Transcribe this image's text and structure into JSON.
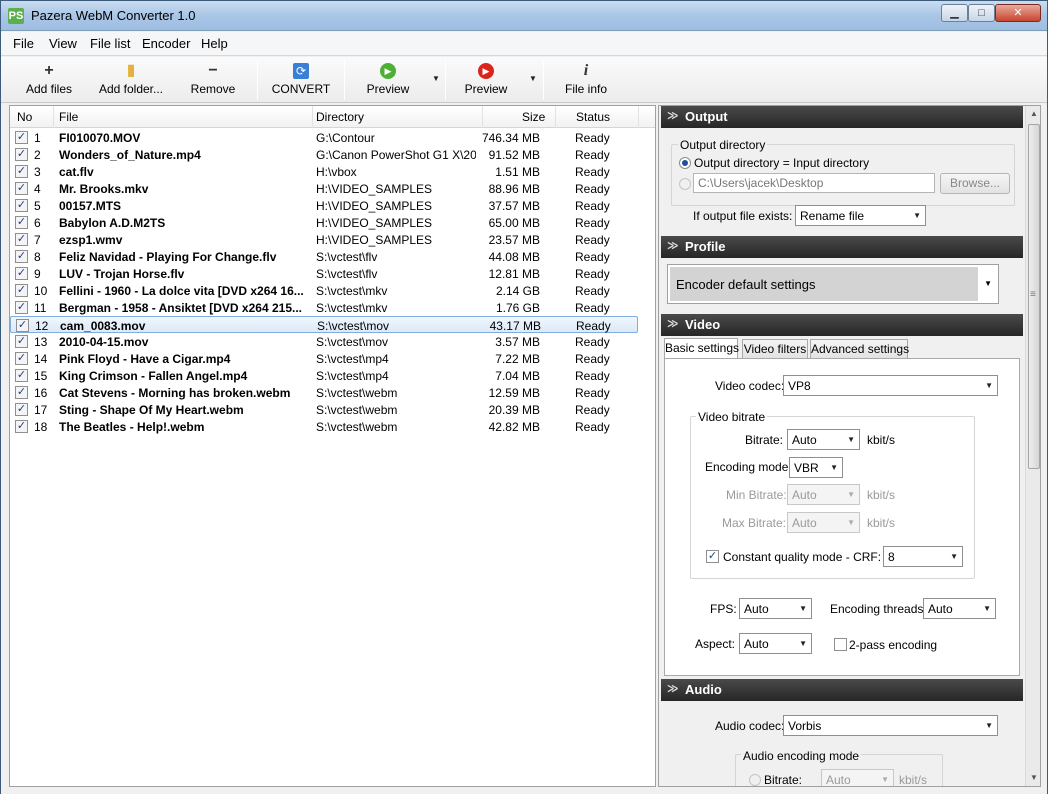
{
  "window": {
    "title": "Pazera WebM Converter 1.0",
    "app_icon": "PS"
  },
  "window_controls": {
    "minimize": "▁",
    "maximize": "□",
    "close": "✕"
  },
  "menu": [
    "File",
    "View",
    "File list",
    "Encoder",
    "Help"
  ],
  "toolbar": {
    "add_files": "Add files",
    "add_folder": "Add folder...",
    "remove": "Remove",
    "convert": "CONVERT",
    "preview1": "Preview",
    "preview2": "Preview",
    "file_info": "File info",
    "icons": {
      "add": "+",
      "folder": "▮",
      "remove": "−",
      "convert": "⟳",
      "play_green": "▶",
      "play_red": "▶",
      "info": "i"
    }
  },
  "file_list": {
    "columns": [
      "No",
      "File",
      "Directory",
      "Size",
      "Status"
    ],
    "rows": [
      {
        "no": "1",
        "file": "FI010070.MOV",
        "dir": "G:\\Contour",
        "size": "746.34 MB",
        "status": "Ready"
      },
      {
        "no": "2",
        "file": "Wonders_of_Nature.mp4",
        "dir": "G:\\Canon PowerShot G1 X\\20...",
        "size": "91.52 MB",
        "status": "Ready"
      },
      {
        "no": "3",
        "file": "cat.flv",
        "dir": "H:\\vbox",
        "size": "1.51 MB",
        "status": "Ready"
      },
      {
        "no": "4",
        "file": "Mr. Brooks.mkv",
        "dir": "H:\\VIDEO_SAMPLES",
        "size": "88.96 MB",
        "status": "Ready"
      },
      {
        "no": "5",
        "file": "00157.MTS",
        "dir": "H:\\VIDEO_SAMPLES",
        "size": "37.57 MB",
        "status": "Ready"
      },
      {
        "no": "6",
        "file": "Babylon A.D.M2TS",
        "dir": "H:\\VIDEO_SAMPLES",
        "size": "65.00 MB",
        "status": "Ready"
      },
      {
        "no": "7",
        "file": "ezsp1.wmv",
        "dir": "H:\\VIDEO_SAMPLES",
        "size": "23.57 MB",
        "status": "Ready"
      },
      {
        "no": "8",
        "file": "Feliz Navidad - Playing For Change.flv",
        "dir": "S:\\vctest\\flv",
        "size": "44.08 MB",
        "status": "Ready"
      },
      {
        "no": "9",
        "file": "LUV - Trojan Horse.flv",
        "dir": "S:\\vctest\\flv",
        "size": "12.81 MB",
        "status": "Ready"
      },
      {
        "no": "10",
        "file": "Fellini - 1960 - La dolce vita [DVD x264 16...",
        "dir": "S:\\vctest\\mkv",
        "size": "2.14 GB",
        "status": "Ready"
      },
      {
        "no": "11",
        "file": "Bergman - 1958 - Ansiktet [DVD x264 215...",
        "dir": "S:\\vctest\\mkv",
        "size": "1.76 GB",
        "status": "Ready"
      },
      {
        "no": "12",
        "file": "cam_0083.mov",
        "dir": "S:\\vctest\\mov",
        "size": "43.17 MB",
        "status": "Ready"
      },
      {
        "no": "13",
        "file": "2010-04-15.mov",
        "dir": "S:\\vctest\\mov",
        "size": "3.57 MB",
        "status": "Ready"
      },
      {
        "no": "14",
        "file": "Pink Floyd - Have a Cigar.mp4",
        "dir": "S:\\vctest\\mp4",
        "size": "7.22 MB",
        "status": "Ready"
      },
      {
        "no": "15",
        "file": "King Crimson - Fallen Angel.mp4",
        "dir": "S:\\vctest\\mp4",
        "size": "7.04 MB",
        "status": "Ready"
      },
      {
        "no": "16",
        "file": "Cat Stevens - Morning has broken.webm",
        "dir": "S:\\vctest\\webm",
        "size": "12.59 MB",
        "status": "Ready"
      },
      {
        "no": "17",
        "file": "Sting - Shape Of My Heart.webm",
        "dir": "S:\\vctest\\webm",
        "size": "20.39 MB",
        "status": "Ready"
      },
      {
        "no": "18",
        "file": "The Beatles - Help!.webm",
        "dir": "S:\\vctest\\webm",
        "size": "42.82 MB",
        "status": "Ready"
      }
    ],
    "selected_row": "12",
    "checkmark": "✓"
  },
  "output": {
    "header": "Output",
    "group_title": "Output directory",
    "radio_same": "Output directory = Input directory",
    "path_value": "C:\\Users\\jacek\\Desktop",
    "browse": "Browse...",
    "exists_label": "If output file exists:",
    "exists_value": "Rename file"
  },
  "profile": {
    "header": "Profile",
    "value": "Encoder default settings"
  },
  "video": {
    "header": "Video",
    "tabs": [
      "Basic settings",
      "Video filters",
      "Advanced settings"
    ],
    "codec_label": "Video codec:",
    "codec_value": "VP8",
    "bitrate_group": "Video bitrate",
    "bitrate_label": "Bitrate:",
    "bitrate_value": "Auto",
    "unit": "kbit/s",
    "mode_label": "Encoding mode:",
    "mode_value": "VBR",
    "min_label": "Min Bitrate:",
    "min_value": "Auto",
    "max_label": "Max Bitrate:",
    "max_value": "Auto",
    "crf_label": "Constant quality mode - CRF:",
    "crf_value": "8",
    "fps_label": "FPS:",
    "fps_value": "Auto",
    "threads_label": "Encoding threads:",
    "threads_value": "Auto",
    "aspect_label": "Aspect:",
    "aspect_value": "Auto",
    "twopass_label": "2-pass encoding"
  },
  "audio": {
    "header": "Audio",
    "codec_label": "Audio codec:",
    "codec_value": "Vorbis",
    "mode_group": "Audio encoding mode",
    "bitrate_label": "Bitrate:",
    "bitrate_value": "Auto",
    "unit": "kbit/s"
  },
  "glyphs": {
    "dropdown": "▼",
    "collapse": "≫",
    "scroll_up": "▲",
    "scroll_down": "▼",
    "grip": "≡"
  }
}
